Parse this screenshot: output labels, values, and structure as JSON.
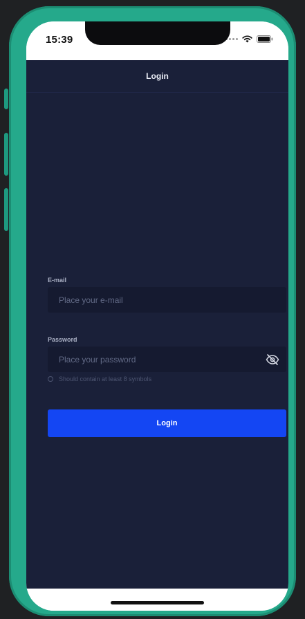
{
  "status_bar": {
    "time": "15:39",
    "icons": [
      "signal-dots-icon",
      "wifi-icon",
      "battery-icon"
    ]
  },
  "nav": {
    "title": "Login"
  },
  "form": {
    "email": {
      "label": "E-mail",
      "placeholder": "Place your e-mail",
      "value": ""
    },
    "password": {
      "label": "Password",
      "placeholder": "Place your password",
      "value": "",
      "toggle_icon": "eye-off-icon",
      "hint": "Should contain at least 8 symbols"
    },
    "submit_label": "Login"
  },
  "colors": {
    "device_frame": "#25a98b",
    "app_background": "#1a2039",
    "input_background": "#151a30",
    "primary_button": "#1446f3"
  }
}
